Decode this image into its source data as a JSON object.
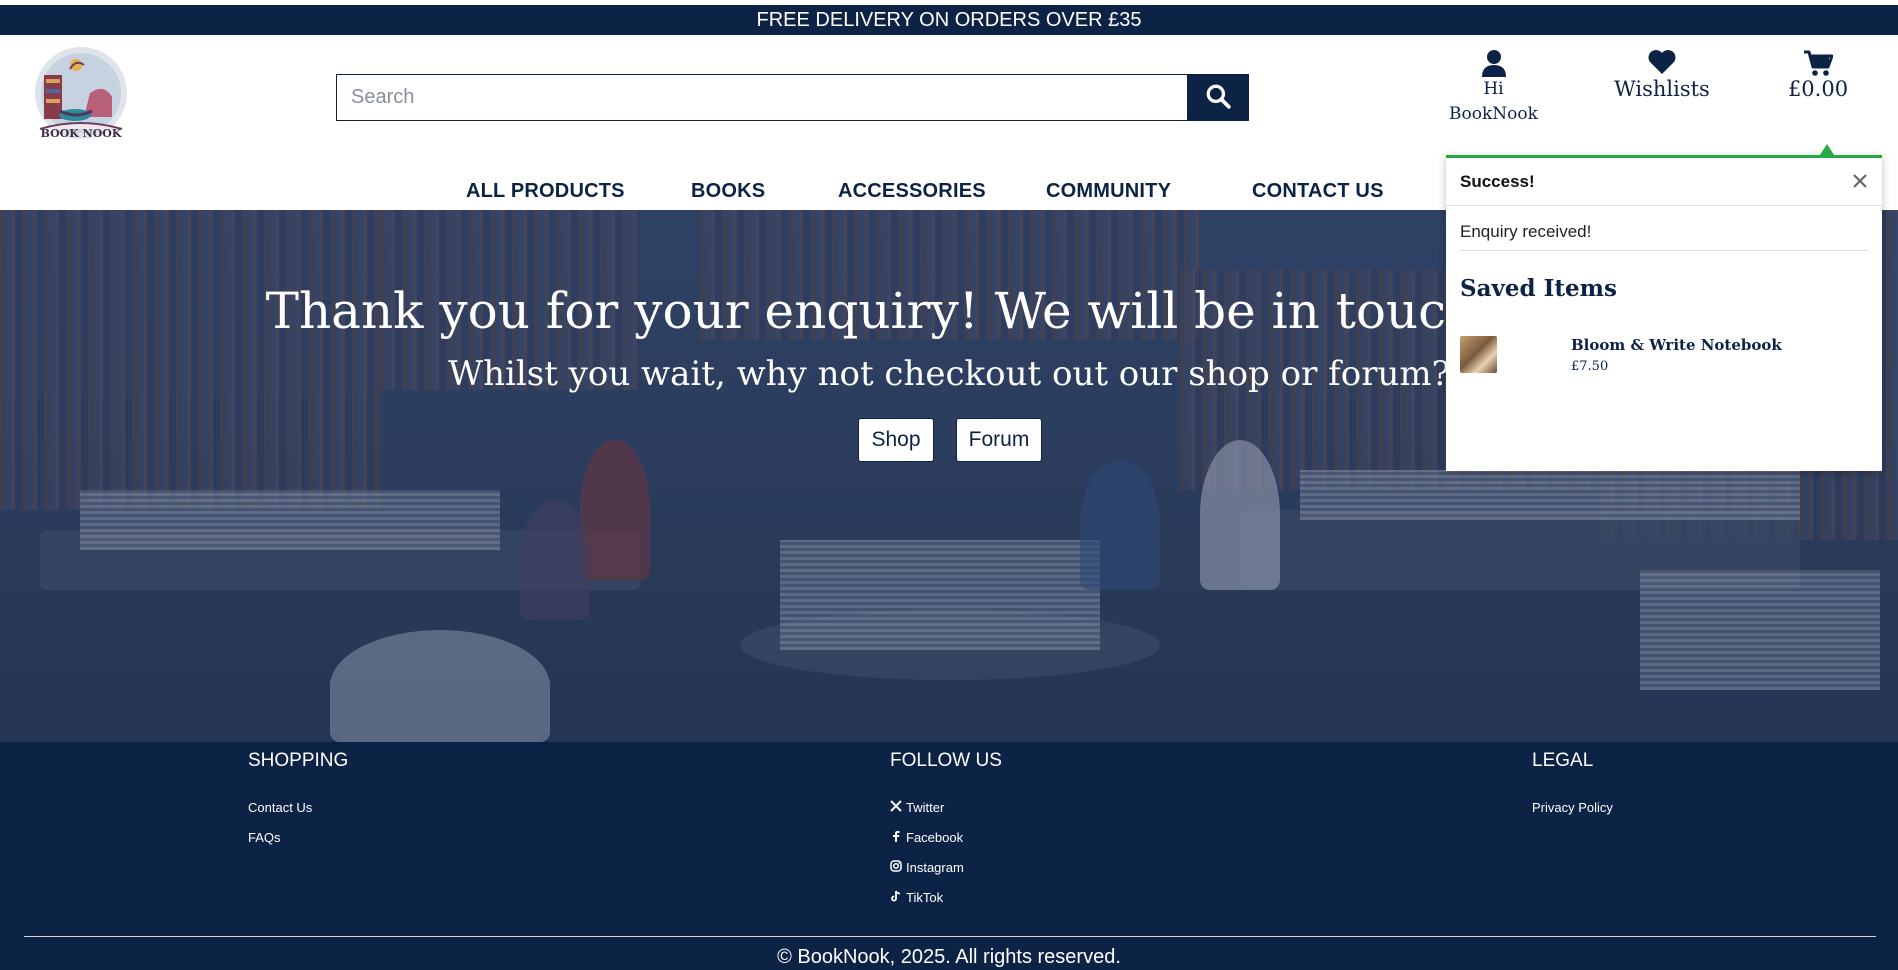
{
  "topbar": {
    "text": "FREE DELIVERY ON ORDERS OVER £35"
  },
  "header": {
    "logo_icon": "book-nook-logo",
    "logo_text": "BOOK NOOK",
    "search_placeholder": "Search",
    "search_icon": "search-icon",
    "account": {
      "line1": "Hi",
      "line2": "BookNook",
      "icon": "user-icon"
    },
    "wishlist": {
      "label": "Wishlists",
      "icon": "heart-icon"
    },
    "bag": {
      "total": "£0.00",
      "icon": "cart-icon"
    }
  },
  "nav": {
    "items": [
      {
        "label": "ALL PRODUCTS"
      },
      {
        "label": "BOOKS"
      },
      {
        "label": "ACCESSORIES"
      },
      {
        "label": "COMMUNITY"
      },
      {
        "label": "CONTACT US"
      }
    ]
  },
  "hero": {
    "heading": "Thank you for your enquiry! We will be in touch soon!",
    "subheading": "Whilst you wait, why not checkout out our shop or forum?",
    "shop_button": "Shop",
    "forum_button": "Forum"
  },
  "toast": {
    "title": "Success!",
    "message": "Enquiry received!",
    "saved_heading": "Saved Items",
    "item": {
      "name": "Bloom & Write Notebook",
      "price": "£7.50"
    },
    "accent_color": "#28a745"
  },
  "footer": {
    "shopping": {
      "heading": "SHOPPING",
      "links": [
        "Contact Us",
        "FAQs"
      ]
    },
    "follow": {
      "heading": "FOLLOW US",
      "links": [
        {
          "label": "Twitter",
          "icon": "x-icon"
        },
        {
          "label": "Facebook",
          "icon": "facebook-icon"
        },
        {
          "label": "Instagram",
          "icon": "instagram-icon"
        },
        {
          "label": "TikTok",
          "icon": "tiktok-icon"
        }
      ]
    },
    "legal": {
      "heading": "LEGAL",
      "links": [
        "Privacy Policy"
      ]
    },
    "copyright": "© BookNook, 2025. All rights reserved."
  },
  "colors": {
    "navy": "#0c2346",
    "white": "#ffffff",
    "success": "#28a745"
  }
}
